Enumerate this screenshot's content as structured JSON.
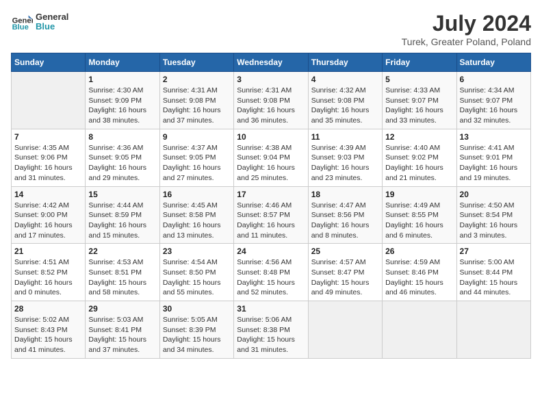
{
  "header": {
    "logo_line1": "General",
    "logo_line2": "Blue",
    "title": "July 2024",
    "subtitle": "Turek, Greater Poland, Poland"
  },
  "columns": [
    "Sunday",
    "Monday",
    "Tuesday",
    "Wednesday",
    "Thursday",
    "Friday",
    "Saturday"
  ],
  "weeks": [
    [
      {
        "day": "",
        "info": ""
      },
      {
        "day": "1",
        "info": "Sunrise: 4:30 AM\nSunset: 9:09 PM\nDaylight: 16 hours and 38 minutes."
      },
      {
        "day": "2",
        "info": "Sunrise: 4:31 AM\nSunset: 9:08 PM\nDaylight: 16 hours and 37 minutes."
      },
      {
        "day": "3",
        "info": "Sunrise: 4:31 AM\nSunset: 9:08 PM\nDaylight: 16 hours and 36 minutes."
      },
      {
        "day": "4",
        "info": "Sunrise: 4:32 AM\nSunset: 9:08 PM\nDaylight: 16 hours and 35 minutes."
      },
      {
        "day": "5",
        "info": "Sunrise: 4:33 AM\nSunset: 9:07 PM\nDaylight: 16 hours and 33 minutes."
      },
      {
        "day": "6",
        "info": "Sunrise: 4:34 AM\nSunset: 9:07 PM\nDaylight: 16 hours and 32 minutes."
      }
    ],
    [
      {
        "day": "7",
        "info": "Sunrise: 4:35 AM\nSunset: 9:06 PM\nDaylight: 16 hours and 31 minutes."
      },
      {
        "day": "8",
        "info": "Sunrise: 4:36 AM\nSunset: 9:05 PM\nDaylight: 16 hours and 29 minutes."
      },
      {
        "day": "9",
        "info": "Sunrise: 4:37 AM\nSunset: 9:05 PM\nDaylight: 16 hours and 27 minutes."
      },
      {
        "day": "10",
        "info": "Sunrise: 4:38 AM\nSunset: 9:04 PM\nDaylight: 16 hours and 25 minutes."
      },
      {
        "day": "11",
        "info": "Sunrise: 4:39 AM\nSunset: 9:03 PM\nDaylight: 16 hours and 23 minutes."
      },
      {
        "day": "12",
        "info": "Sunrise: 4:40 AM\nSunset: 9:02 PM\nDaylight: 16 hours and 21 minutes."
      },
      {
        "day": "13",
        "info": "Sunrise: 4:41 AM\nSunset: 9:01 PM\nDaylight: 16 hours and 19 minutes."
      }
    ],
    [
      {
        "day": "14",
        "info": "Sunrise: 4:42 AM\nSunset: 9:00 PM\nDaylight: 16 hours and 17 minutes."
      },
      {
        "day": "15",
        "info": "Sunrise: 4:44 AM\nSunset: 8:59 PM\nDaylight: 16 hours and 15 minutes."
      },
      {
        "day": "16",
        "info": "Sunrise: 4:45 AM\nSunset: 8:58 PM\nDaylight: 16 hours and 13 minutes."
      },
      {
        "day": "17",
        "info": "Sunrise: 4:46 AM\nSunset: 8:57 PM\nDaylight: 16 hours and 11 minutes."
      },
      {
        "day": "18",
        "info": "Sunrise: 4:47 AM\nSunset: 8:56 PM\nDaylight: 16 hours and 8 minutes."
      },
      {
        "day": "19",
        "info": "Sunrise: 4:49 AM\nSunset: 8:55 PM\nDaylight: 16 hours and 6 minutes."
      },
      {
        "day": "20",
        "info": "Sunrise: 4:50 AM\nSunset: 8:54 PM\nDaylight: 16 hours and 3 minutes."
      }
    ],
    [
      {
        "day": "21",
        "info": "Sunrise: 4:51 AM\nSunset: 8:52 PM\nDaylight: 16 hours and 0 minutes."
      },
      {
        "day": "22",
        "info": "Sunrise: 4:53 AM\nSunset: 8:51 PM\nDaylight: 15 hours and 58 minutes."
      },
      {
        "day": "23",
        "info": "Sunrise: 4:54 AM\nSunset: 8:50 PM\nDaylight: 15 hours and 55 minutes."
      },
      {
        "day": "24",
        "info": "Sunrise: 4:56 AM\nSunset: 8:48 PM\nDaylight: 15 hours and 52 minutes."
      },
      {
        "day": "25",
        "info": "Sunrise: 4:57 AM\nSunset: 8:47 PM\nDaylight: 15 hours and 49 minutes."
      },
      {
        "day": "26",
        "info": "Sunrise: 4:59 AM\nSunset: 8:46 PM\nDaylight: 15 hours and 46 minutes."
      },
      {
        "day": "27",
        "info": "Sunrise: 5:00 AM\nSunset: 8:44 PM\nDaylight: 15 hours and 44 minutes."
      }
    ],
    [
      {
        "day": "28",
        "info": "Sunrise: 5:02 AM\nSunset: 8:43 PM\nDaylight: 15 hours and 41 minutes."
      },
      {
        "day": "29",
        "info": "Sunrise: 5:03 AM\nSunset: 8:41 PM\nDaylight: 15 hours and 37 minutes."
      },
      {
        "day": "30",
        "info": "Sunrise: 5:05 AM\nSunset: 8:39 PM\nDaylight: 15 hours and 34 minutes."
      },
      {
        "day": "31",
        "info": "Sunrise: 5:06 AM\nSunset: 8:38 PM\nDaylight: 15 hours and 31 minutes."
      },
      {
        "day": "",
        "info": ""
      },
      {
        "day": "",
        "info": ""
      },
      {
        "day": "",
        "info": ""
      }
    ]
  ]
}
